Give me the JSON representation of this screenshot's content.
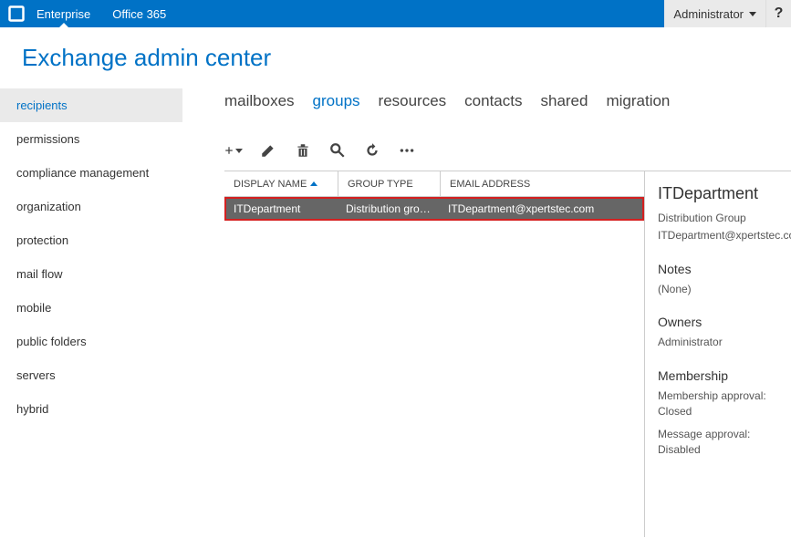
{
  "topbar": {
    "tabs": [
      "Enterprise",
      "Office 365"
    ],
    "activeTab": "Enterprise",
    "user": "Administrator",
    "help": "?"
  },
  "pageTitle": "Exchange admin center",
  "sidebar": {
    "items": [
      "recipients",
      "permissions",
      "compliance management",
      "organization",
      "protection",
      "mail flow",
      "mobile",
      "public folders",
      "servers",
      "hybrid"
    ],
    "selected": "recipients"
  },
  "subtabs": {
    "items": [
      "mailboxes",
      "groups",
      "resources",
      "contacts",
      "shared",
      "migration"
    ],
    "selected": "groups"
  },
  "table": {
    "columns": [
      "DISPLAY NAME",
      "GROUP TYPE",
      "EMAIL ADDRESS"
    ],
    "sortColumn": "DISPLAY NAME",
    "rows": [
      {
        "name": "ITDepartment",
        "type": "Distribution gro…",
        "email": "ITDepartment@xpertstec.com"
      }
    ]
  },
  "details": {
    "title": "ITDepartment",
    "groupType": "Distribution Group",
    "email": "ITDepartment@xpertstec.com",
    "sections": {
      "notes": {
        "label": "Notes",
        "value": "(None)"
      },
      "owners": {
        "label": "Owners",
        "value": "Administrator"
      },
      "membership": {
        "label": "Membership",
        "approvalLabel": "Membership approval:",
        "approvalValue": "Closed",
        "messageLabel": "Message approval:",
        "messageValue": "Disabled"
      }
    }
  }
}
